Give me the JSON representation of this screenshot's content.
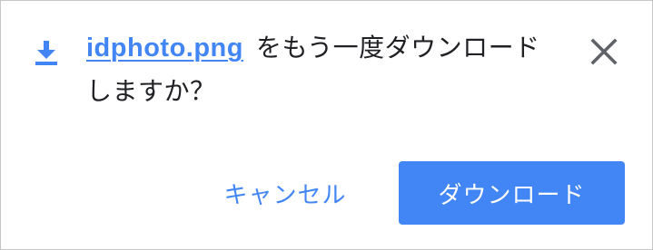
{
  "dialog": {
    "filename": "idphoto.png",
    "message": "をもう一度ダウンロードしますか？",
    "cancel_label": "キャンセル",
    "download_label": "ダウンロード"
  },
  "icons": {
    "download": "download-icon",
    "close": "close-icon"
  },
  "colors": {
    "accent": "#4285f4",
    "text": "#202124",
    "icon": "#5f6368",
    "border": "#c6c6c6"
  }
}
